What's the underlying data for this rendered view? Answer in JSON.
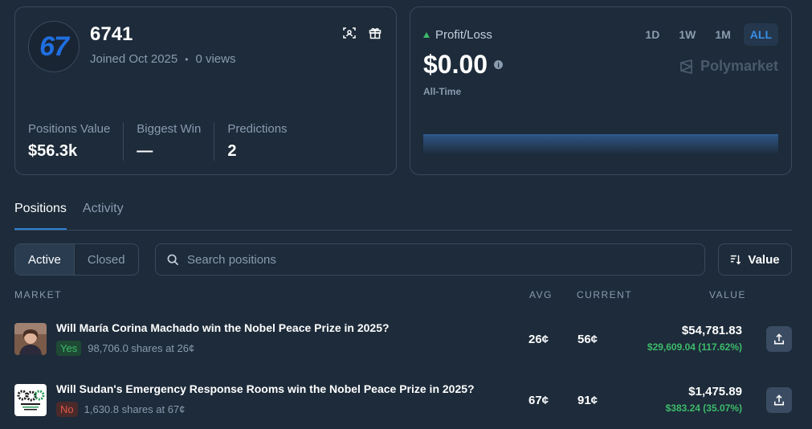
{
  "profile": {
    "avatar_text": "67",
    "username": "6741",
    "joined": "Joined Oct 2025",
    "separator": "•",
    "views": "0 views",
    "icons": [
      "scan-icon",
      "gift-icon"
    ],
    "stats": [
      {
        "label": "Positions Value",
        "value": "$56.3k"
      },
      {
        "label": "Biggest Win",
        "value": "—"
      },
      {
        "label": "Predictions",
        "value": "2"
      }
    ]
  },
  "pnl": {
    "label": "Profit/Loss",
    "value": "$0.00",
    "period": "All-Time",
    "ranges": [
      "1D",
      "1W",
      "1M",
      "ALL"
    ],
    "active_range": "ALL",
    "brand": "Polymarket"
  },
  "tabs": [
    "Positions",
    "Activity"
  ],
  "active_tab": "Positions",
  "filters": {
    "toggle": [
      "Active",
      "Closed"
    ],
    "active": "Active",
    "search_placeholder": "Search positions",
    "sort_label": "Value"
  },
  "columns": {
    "market": "MARKET",
    "avg": "AVG",
    "current": "CURRENT",
    "value": "VALUE"
  },
  "positions": [
    {
      "title": "Will María Corina Machado win the Nobel Peace Prize in 2025?",
      "outcome": "Yes",
      "shares": "98,706.0 shares at 26¢",
      "avg": "26¢",
      "current": "56¢",
      "value": "$54,781.83",
      "pnl": "$29,609.04 (117.62%)"
    },
    {
      "title": "Will Sudan's Emergency Response Rooms win the Nobel Peace Prize in 2025?",
      "outcome": "No",
      "shares": "1,630.8 shares at 67¢",
      "avg": "67¢",
      "current": "91¢",
      "value": "$1,475.89",
      "pnl": "$383.24 (35.07%)"
    }
  ],
  "colors": {
    "background": "#1d2b3a",
    "accent": "#2f7fd6",
    "positive": "#3dbb6a",
    "negative": "#e05a4a"
  }
}
